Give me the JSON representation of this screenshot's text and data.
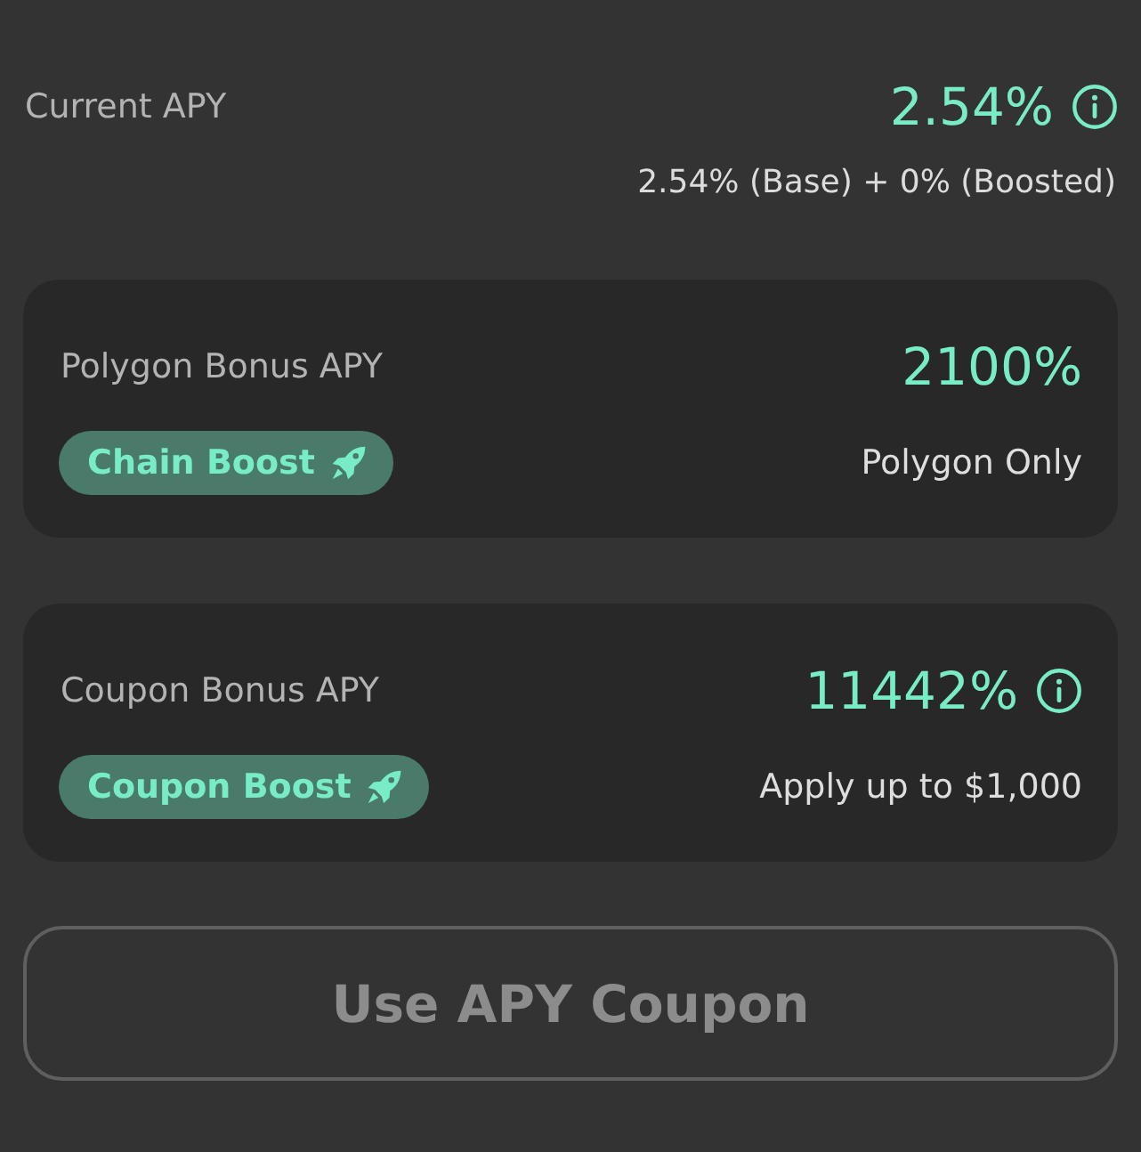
{
  "current_apy": {
    "label": "Current APY",
    "value": "2.54%",
    "info_icon": true,
    "breakdown": "2.54% (Base) + 0% (Boosted)"
  },
  "bonus_cards": [
    {
      "label": "Polygon Bonus APY",
      "value": "2100%",
      "info_icon": false,
      "badge": "Chain Boost",
      "note": "Polygon Only"
    },
    {
      "label": "Coupon Bonus APY",
      "value": "11442%",
      "info_icon": true,
      "badge": "Coupon Boost",
      "note": "Apply up to $1,000"
    }
  ],
  "action_button": {
    "label": "Use APY Coupon",
    "disabled": true
  }
}
